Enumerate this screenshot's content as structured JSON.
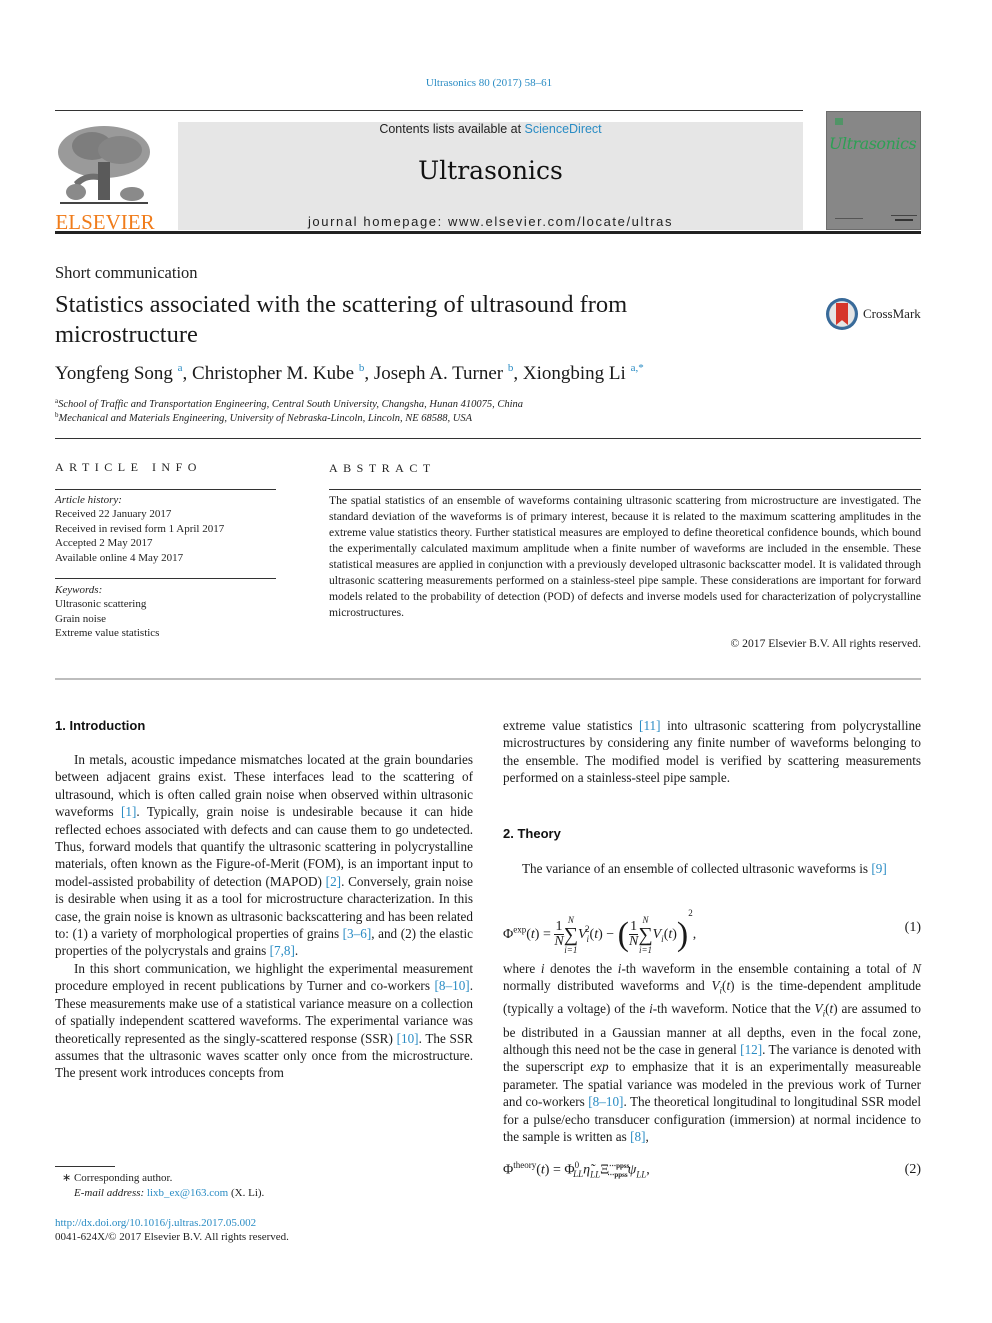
{
  "header": {
    "journal_ref": "Ultrasonics 80 (2017) 58–61",
    "publisher": "ELSEVIER",
    "contents_prefix": "Contents lists available at ",
    "contents_link": "ScienceDirect",
    "journal_name": "Ultrasonics",
    "homepage": "journal homepage: www.elsevier.com/locate/ultras",
    "cover_title": "Ultrasonics"
  },
  "article": {
    "type": "Short communication",
    "title": "Statistics associated with the scattering of ultrasound from microstructure",
    "crossmark": "CrossMark",
    "authors": [
      {
        "name": "Yongfeng Song",
        "sup": "a"
      },
      {
        "name": "Christopher M. Kube",
        "sup": "b"
      },
      {
        "name": "Joseph A. Turner",
        "sup": "b"
      },
      {
        "name": "Xiongbing Li",
        "sup": "a,*"
      }
    ],
    "affiliations": [
      {
        "key": "a",
        "text": "School of Traffic and Transportation Engineering, Central South University, Changsha, Hunan 410075, China"
      },
      {
        "key": "b",
        "text": "Mechanical and Materials Engineering, University of Nebraska-Lincoln, Lincoln, NE 68588, USA"
      }
    ]
  },
  "article_info": {
    "heading": "ARTICLE INFO",
    "history_label": "Article history:",
    "history": [
      "Received 22 January 2017",
      "Received in revised form 1 April 2017",
      "Accepted 2 May 2017",
      "Available online 4 May 2017"
    ],
    "keywords_label": "Keywords:",
    "keywords": [
      "Ultrasonic scattering",
      "Grain noise",
      "Extreme value statistics"
    ]
  },
  "abstract": {
    "heading": "ABSTRACT",
    "text": "The spatial statistics of an ensemble of waveforms containing ultrasonic scattering from microstructure are investigated. The standard deviation of the waveforms is of primary interest, because it is related to the maximum scattering amplitudes in the extreme value statistics theory. Further statistical measures are employed to define theoretical confidence bounds, which bound the experimentally calculated maximum amplitude when a finite number of waveforms are included in the ensemble. These statistical measures are applied in conjunction with a previously developed ultrasonic backscatter model. It is validated through ultrasonic scattering measurements performed on a stainless-steel pipe sample. These considerations are important for forward models related to the probability of detection (POD) of defects and inverse models used for characterization of polycrystalline microstructures.",
    "copyright": "© 2017 Elsevier B.V. All rights reserved."
  },
  "body": {
    "intro_title": "1. Introduction",
    "intro_p1": [
      {
        "t": "In metals, acoustic impedance mismatches located at the grain boundaries between adjacent grains exist. These interfaces lead to the scattering of ultrasound, which is often called grain noise when observed within ultrasonic waveforms "
      },
      {
        "ref": "[1]"
      },
      {
        "t": ". Typically, grain noise is undesirable because it can hide reflected echoes associated with defects and can cause them to go undetected. Thus, forward models that quantify the ultrasonic scattering in polycrystalline materials, often known as the Figure-of-Merit (FOM), is an important input to model-assisted probability of detection (MAPOD) "
      },
      {
        "ref": "[2]"
      },
      {
        "t": ". Conversely, grain noise is desirable when using it as a tool for microstructure characterization. In this case, the grain noise is known as ultrasonic backscattering and has been related to: (1) a variety of morphological properties of grains "
      },
      {
        "ref": "[3–6]"
      },
      {
        "t": ", and (2) the elastic properties of the polycrystals and grains "
      },
      {
        "ref": "[7,8]"
      },
      {
        "t": "."
      }
    ],
    "intro_p2": [
      {
        "t": "In this short communication, we highlight the experimental measurement procedure employed in recent publications by Turner and co-workers "
      },
      {
        "ref": "[8–10]"
      },
      {
        "t": ". These measurements make use of a statistical variance measure on a collection of spatially independent scattered waveforms. The experimental variance was theoretically represented as the singly-scattered response (SSR) "
      },
      {
        "ref": "[10]"
      },
      {
        "t": ". The SSR assumes that the ultrasonic waves scatter only once from the microstructure. The present work introduces concepts from"
      }
    ],
    "right_p1": [
      {
        "t": "extreme value statistics "
      },
      {
        "ref": "[11]"
      },
      {
        "t": " into ultrasonic scattering from polycrystalline microstructures by considering any finite number of waveforms belonging to the ensemble. The modified model is verified by scattering measurements performed on a stainless-steel pipe sample."
      }
    ],
    "theory_title": "2. Theory",
    "theory_p1": [
      {
        "t": "The variance of an ensemble of collected ultrasonic waveforms is "
      },
      {
        "ref": "[9]"
      }
    ],
    "eq1_number": "(1)",
    "where_p": [
      {
        "t": "where "
      },
      {
        "i": "i"
      },
      {
        "t": " denotes the "
      },
      {
        "i": "i"
      },
      {
        "t": "-th waveform in the ensemble containing a total of "
      },
      {
        "i": "N"
      },
      {
        "t": " normally distributed waveforms and "
      },
      {
        "i": "V"
      },
      {
        "sub": "i"
      },
      {
        "t": "("
      },
      {
        "i": "t"
      },
      {
        "t": ") is the time-dependent amplitude (typically a voltage) of the "
      },
      {
        "i": "i"
      },
      {
        "t": "-th waveform. Notice that the "
      },
      {
        "i": "V"
      },
      {
        "sub": "i"
      },
      {
        "t": "("
      },
      {
        "i": "t"
      },
      {
        "t": ") are assumed to be distributed in a Gaussian manner at all depths, even in the focal zone, although this need not be the case in general "
      },
      {
        "ref": "[12]"
      },
      {
        "t": ". The variance is denoted with the superscript "
      },
      {
        "i": "exp"
      },
      {
        "t": " to emphasize that it is an experimentally measureable parameter. The spatial variance was modeled in the previous work of Turner and co-workers "
      },
      {
        "ref": "[8–10]"
      },
      {
        "t": ". The theoretical longitudinal to longitudinal SSR model for a pulse/echo transducer configuration (immersion) at normal incidence to the sample is written as "
      },
      {
        "ref": "[8]"
      },
      {
        "t": ","
      }
    ],
    "eq2_number": "(2)"
  },
  "footer": {
    "corresponding": "Corresponding author.",
    "email_label": "E-mail address: ",
    "email": "lixb_ex@163.com",
    "email_suffix": " (X. Li).",
    "doi": "http://dx.doi.org/10.1016/j.ultras.2017.05.002",
    "issn": "0041-624X/© 2017 Elsevier B.V. All rights reserved."
  }
}
